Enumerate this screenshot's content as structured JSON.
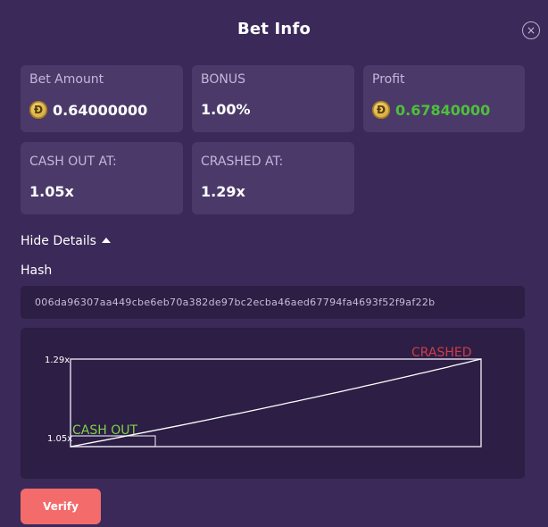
{
  "modal": {
    "title": "Bet Info",
    "close_icon": "×"
  },
  "cards": {
    "bet_amount": {
      "label": "Bet Amount",
      "value": "0.64000000",
      "coin": "Ð"
    },
    "bonus": {
      "label": "BONUS",
      "value": "1.00%"
    },
    "profit": {
      "label": "Profit",
      "value": "0.67840000",
      "coin": "Ð",
      "value_color": "#4fbf3c"
    },
    "cash_out_at": {
      "label": "CASH OUT AT:",
      "value": "1.05x"
    },
    "crashed_at": {
      "label": "CRASHED AT:",
      "value": "1.29x"
    }
  },
  "details": {
    "toggle_label": "Hide Details",
    "hash_label": "Hash",
    "hash_value": "006da96307aa449cbe6eb70a382de97bc2ecba46aed67794fa4693f52f9af22b"
  },
  "chart_data": {
    "type": "line",
    "ytick_labels": [
      "1.29x",
      "1.05x"
    ],
    "annotations": {
      "cash_out": {
        "label": "CASH OUT",
        "value": 1.05,
        "color": "#7fd14a"
      },
      "crashed": {
        "label": "CRASHED",
        "value": 1.29,
        "color": "#d23b4a"
      }
    },
    "ylim": [
      1.0,
      1.29
    ]
  },
  "actions": {
    "verify_label": "Verify"
  },
  "colors": {
    "background": "#3b2959",
    "card": "#4b3a69",
    "verify_button": "#f36b6b"
  }
}
